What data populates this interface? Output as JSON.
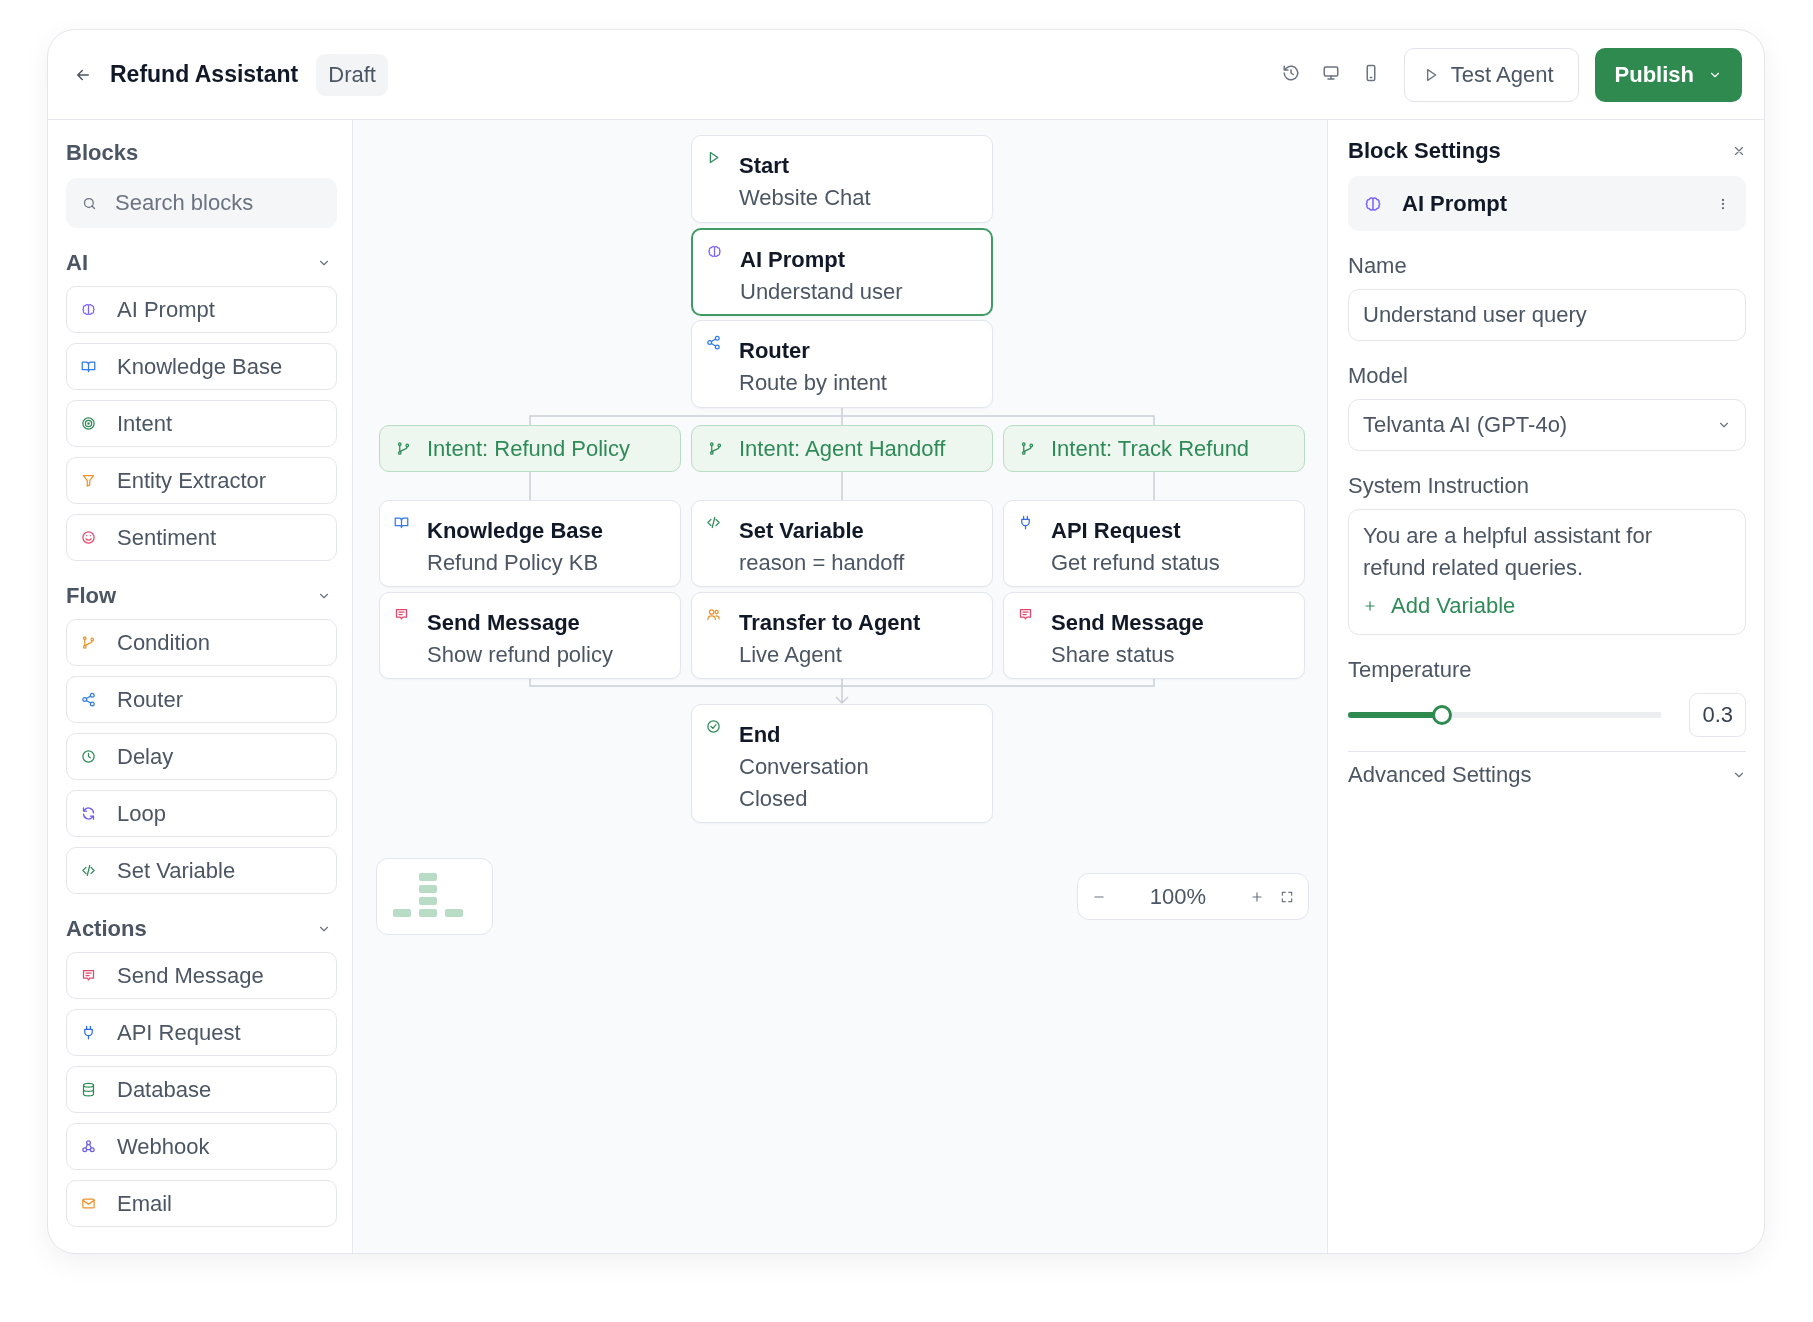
{
  "header": {
    "title": "Refund Assistant",
    "status": "Draft",
    "test_button": "Test Agent",
    "publish_button": "Publish"
  },
  "sidebar": {
    "title": "Blocks",
    "search": {
      "placeholder": "Search blocks"
    },
    "groups": [
      {
        "title": "AI",
        "expanded": true,
        "items": [
          {
            "kind": "prompt",
            "label": "AI Prompt"
          },
          {
            "kind": "knowledge",
            "label": "Knowledge Base"
          },
          {
            "kind": "intent",
            "label": "Intent"
          },
          {
            "kind": "extractor",
            "label": "Entity Extractor"
          },
          {
            "kind": "sentiment",
            "label": "Sentiment"
          }
        ]
      },
      {
        "title": "Flow",
        "expanded": true,
        "items": [
          {
            "kind": "condition",
            "label": "Condition"
          },
          {
            "kind": "router",
            "label": "Router"
          },
          {
            "kind": "delay",
            "label": "Delay"
          },
          {
            "kind": "loop",
            "label": "Loop"
          },
          {
            "kind": "variable",
            "label": "Set Variable"
          }
        ]
      },
      {
        "title": "Actions",
        "expanded": true,
        "items": [
          {
            "kind": "message",
            "label": "Send Message"
          },
          {
            "kind": "api",
            "label": "API Request"
          },
          {
            "kind": "database",
            "label": "Database"
          },
          {
            "kind": "webhook",
            "label": "Webhook"
          },
          {
            "kind": "email",
            "label": "Email"
          }
        ]
      }
    ]
  },
  "canvas": {
    "top": [
      {
        "kind": "start",
        "title": "Start",
        "subtitle": "Website Chat",
        "selected": false
      },
      {
        "kind": "prompt",
        "title": "AI Prompt",
        "subtitle": "Understand user",
        "selected": true
      },
      {
        "kind": "router",
        "title": "Router",
        "subtitle": "Route by intent",
        "selected": false
      }
    ],
    "branches": [
      {
        "label": "Intent: Refund Policy",
        "steps": [
          {
            "kind": "knowledge",
            "title": "Knowledge Base",
            "subtitle": "Refund Policy KB",
            "selected": false
          },
          {
            "kind": "message",
            "title": "Send Message",
            "subtitle": "Show refund policy",
            "selected": false
          }
        ]
      },
      {
        "label": "Intent: Agent Handoff",
        "steps": [
          {
            "kind": "variable",
            "title": "Set Variable",
            "subtitle": "reason = handoff",
            "selected": false
          },
          {
            "kind": "transfer",
            "title": "Transfer to Agent",
            "subtitle": "Live Agent",
            "selected": false
          }
        ]
      },
      {
        "label": "Intent: Track Refund",
        "steps": [
          {
            "kind": "api",
            "title": "API Request",
            "subtitle": "Get refund status",
            "selected": false
          },
          {
            "kind": "message",
            "title": "Send Message",
            "subtitle": "Share status",
            "selected": false
          }
        ]
      }
    ],
    "end": {
      "kind": "end",
      "title": "End",
      "subtitle": "Conversation Closed",
      "selected": false
    },
    "zoom": "100%"
  },
  "settings": {
    "title": "Block Settings",
    "block": {
      "kind": "prompt",
      "title": "AI Prompt"
    },
    "name": {
      "label": "Name",
      "value": "Understand user query"
    },
    "model": {
      "label": "Model",
      "value": "Telvanta AI (GPT-4o)"
    },
    "instruction": {
      "label": "System Instruction",
      "value": "You are a helpful assistant for refund related queries.",
      "add_link": "Add Variable"
    },
    "temperature": {
      "label": "Temperature",
      "level": 0.3,
      "reading": "0.3"
    },
    "advanced": {
      "label": "Advanced Settings",
      "expanded": false
    }
  }
}
